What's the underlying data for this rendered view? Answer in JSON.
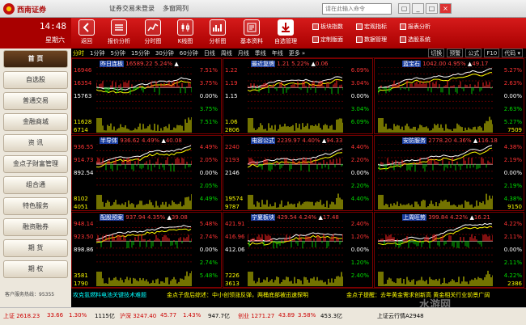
{
  "titlebar": {
    "logo_text": "西南证券",
    "menus": [
      "证券交易未登录",
      "多窗网列"
    ],
    "search_placeholder": "请在此输入命令",
    "win_buttons": [
      "▢",
      "_",
      "□",
      "×"
    ]
  },
  "clock": {
    "time": "14:48",
    "day": "星期六"
  },
  "nav": {
    "items": [
      "首 页",
      "自选股",
      "普通交易",
      "金融商城",
      "资 讯",
      "金点子财富管理",
      "组合通",
      "特色服务",
      "融资融券",
      "期 货",
      "期 权"
    ],
    "hotline": "客户服务热线：95355"
  },
  "toolbar": {
    "buttons": [
      {
        "label": "返回",
        "icon": "back-icon"
      },
      {
        "label": "报价分析",
        "icon": "quote-analysis-icon"
      },
      {
        "label": "分时图",
        "icon": "timeshare-chart-icon"
      },
      {
        "label": "K线图",
        "icon": "kline-icon"
      },
      {
        "label": "分析图",
        "icon": "analysis-chart-icon"
      },
      {
        "label": "基本资料",
        "icon": "basic-info-icon"
      },
      {
        "label": "自选管理",
        "icon": "watchlist-manage-icon"
      }
    ],
    "small": [
      "板块指数",
      "宏观指标",
      "报表分析",
      "定制版面",
      "数据管理",
      "选股系统"
    ]
  },
  "tabs": {
    "items": [
      "分时",
      "1分钟",
      "5分钟",
      "15分钟",
      "30分钟",
      "60分钟",
      "日线",
      "周线",
      "月线",
      "季线",
      "年线",
      "更多 »"
    ],
    "selected": 0,
    "right": [
      "切换",
      "预警",
      "公式",
      "F10",
      "代码 ▾"
    ]
  },
  "colors": {
    "up": "#ff3333",
    "down": "#00dd00",
    "flat": "#ffffff",
    "accent": "#b00000",
    "yellow": "#ffff00"
  },
  "panels": [
    {
      "name": "昨日连板",
      "price": "16589.22",
      "pct": "5.24%",
      "chg": "",
      "y": [
        "16946",
        "16354",
        "15763",
        "",
        "11628",
        "6714"
      ],
      "r": [
        "7.51%",
        "3.75%",
        "0.00%",
        "3.75%",
        "7.51%",
        ""
      ],
      "trend": "up"
    },
    {
      "name": "最近复牌",
      "price": "1.21",
      "pct": "5.22%",
      "chg": "0.06",
      "y": [
        "1.22",
        "1.19",
        "1.15",
        "",
        "1.06",
        "2806"
      ],
      "r": [
        "6.09%",
        "3.04%",
        "0.00%",
        "3.04%",
        "6.09%",
        ""
      ],
      "trend": "mid"
    },
    {
      "name": "蓝宝石",
      "price": "1042.00",
      "pct": "4.95%",
      "chg": "49.17",
      "y": [
        "",
        "",
        "",
        "",
        "",
        ""
      ],
      "r": [
        "5.27%",
        "2.63%",
        "0.00%",
        "2.63%",
        "5.27%",
        "7509"
      ],
      "trend": "up"
    },
    {
      "name": "半导体",
      "price": "936.62",
      "pct": "4.49%",
      "chg": "40.08",
      "y": [
        "936.55",
        "914.73",
        "892.54",
        "",
        "8102",
        "4051"
      ],
      "r": [
        "4.49%",
        "2.05%",
        "0.00%",
        "2.05%",
        "4.49%",
        ""
      ],
      "trend": "up"
    },
    {
      "name": "电容公式",
      "price": "2239.97",
      "pct": "4.40%",
      "chg": "94.33",
      "y": [
        "2240",
        "2193",
        "2146",
        "",
        "19574",
        "9787"
      ],
      "r": [
        "4.40%",
        "2.20%",
        "0.00%",
        "2.20%",
        "4.40%",
        ""
      ],
      "trend": "up"
    },
    {
      "name": "安防服务",
      "price": "2778.20",
      "pct": "4.36%",
      "chg": "116.18",
      "y": [
        "",
        "",
        "",
        "",
        "",
        ""
      ],
      "r": [
        "4.38%",
        "2.19%",
        "0.00%",
        "2.19%",
        "4.38%",
        "9150"
      ],
      "trend": "up"
    },
    {
      "name": "配股预案",
      "price": "937.94",
      "pct": "4.35%",
      "chg": "39.08",
      "y": [
        "948.14",
        "923.50",
        "898.86",
        "",
        "3581",
        "1790"
      ],
      "r": [
        "5.48%",
        "2.74%",
        "0.00%",
        "2.74%",
        "5.48%",
        ""
      ],
      "trend": "up"
    },
    {
      "name": "宁夏板块",
      "price": "429.54",
      "pct": "4.24%",
      "chg": "17.48",
      "y": [
        "421.91",
        "416.96",
        "412.06",
        "",
        "7226",
        "3613"
      ],
      "r": [
        "2.40%",
        "1.20%",
        "0.00%",
        "1.20%",
        "2.40%",
        ""
      ],
      "trend": "up"
    },
    {
      "name": "上周旺势",
      "price": "399.84",
      "pct": "4.22%",
      "chg": "16.21",
      "y": [
        "",
        "",
        "",
        "",
        "",
        ""
      ],
      "r": [
        "4.22%",
        "2.11%",
        "0.00%",
        "2.11%",
        "4.22%",
        "2386"
      ],
      "trend": "up"
    }
  ],
  "news": [
    {
      "text": "攻克氢燃料电池关键技术难题",
      "color": "#00ffff"
    },
    {
      "text": "金点子盘后综述：中小创领涨反弹，两桶底部被迅速探明",
      "color": "#ffff00"
    },
    {
      "text": "金点子提醒：去年黄金需求创新高 黄金相关行业前景广阔",
      "color": "#ffff00"
    }
  ],
  "status": {
    "items": [
      {
        "text": "上证 2618.23",
        "color": "#cc0000"
      },
      {
        "text": "33.66",
        "color": "#cc0000"
      },
      {
        "text": "1.30%",
        "color": "#cc0000"
      },
      {
        "text": "1115亿",
        "color": "#000000"
      },
      {
        "text": "沪深 3247.40",
        "color": "#cc0000"
      },
      {
        "text": "45.77",
        "color": "#cc0000"
      },
      {
        "text": "1.43%",
        "color": "#cc0000"
      },
      {
        "text": "947.7亿",
        "color": "#000000"
      },
      {
        "text": "创业 1271.27",
        "color": "#cc0000"
      },
      {
        "text": "43.89",
        "color": "#cc0000"
      },
      {
        "text": "3.58%",
        "color": "#cc0000"
      },
      {
        "text": "453.3亿",
        "color": "#000000"
      },
      {
        "text": "上证云行情A2948",
        "color": "#000000"
      }
    ]
  },
  "watermark": "水游网"
}
